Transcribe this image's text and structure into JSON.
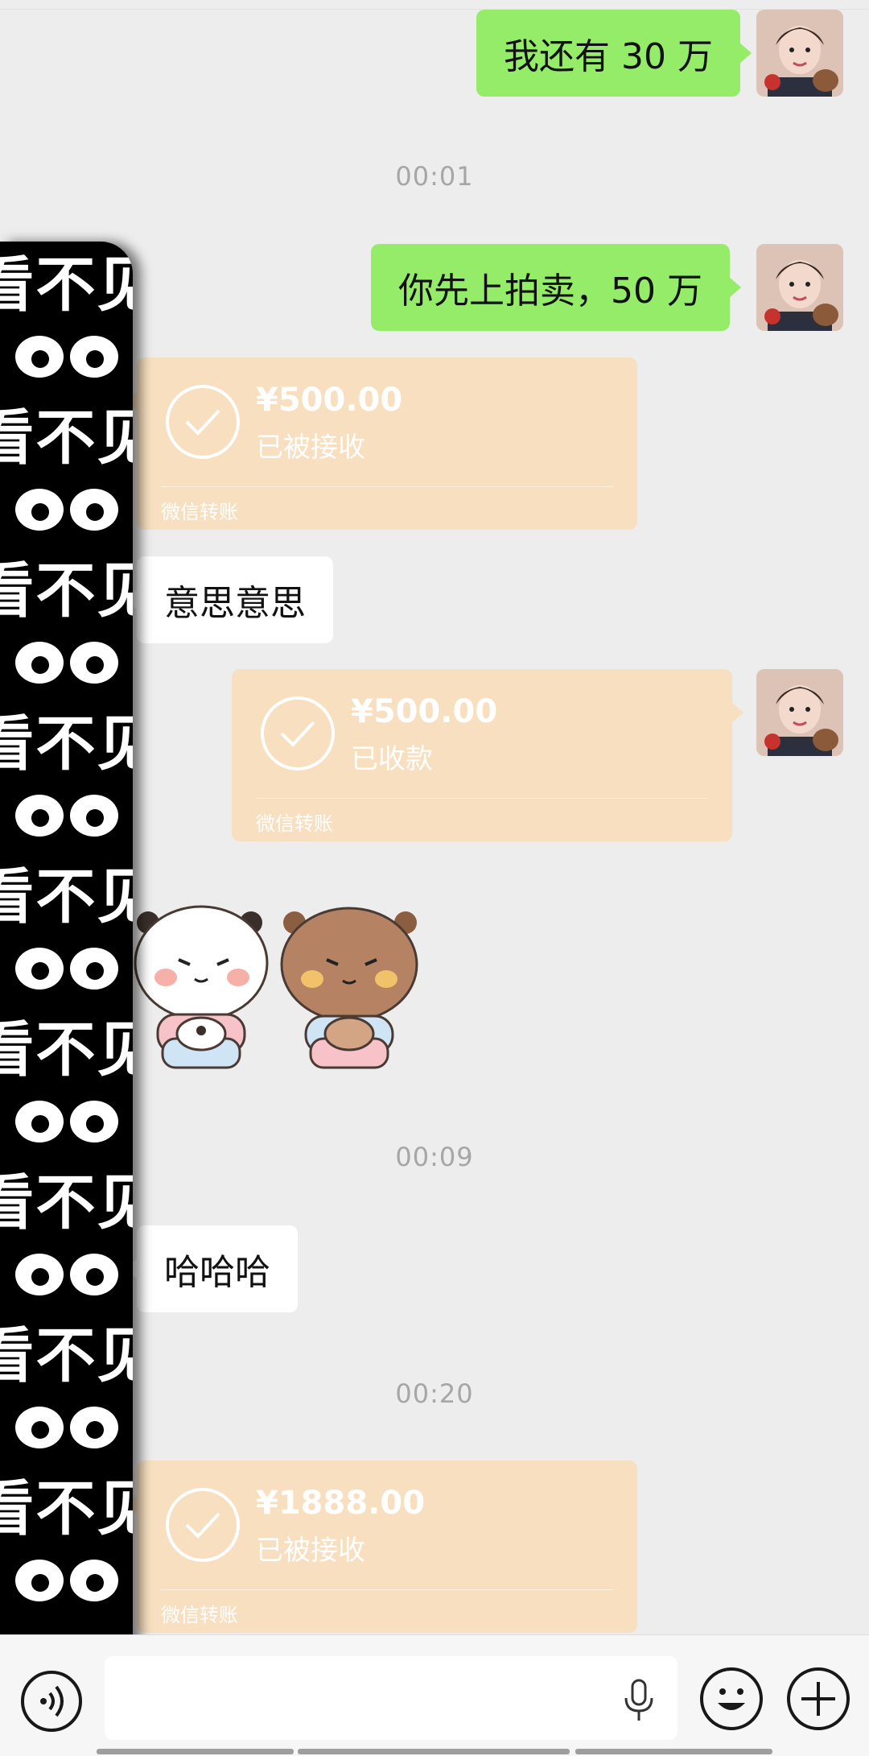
{
  "messages": [
    {
      "type": "text",
      "direction": "out",
      "text": "我还有 30 万"
    },
    {
      "type": "time",
      "text": "00:01"
    },
    {
      "type": "text",
      "direction": "out",
      "text": "你先上拍卖，50 万"
    },
    {
      "type": "transfer",
      "direction": "in",
      "amount": "¥500.00",
      "status": "已被接收",
      "label": "微信转账"
    },
    {
      "type": "text",
      "direction": "in",
      "text": "意思意思"
    },
    {
      "type": "transfer",
      "direction": "out",
      "amount": "¥500.00",
      "status": "已收款",
      "label": "微信转账"
    },
    {
      "type": "sticker",
      "icon": "panda-and-bear-sticker"
    },
    {
      "type": "time",
      "text": "00:09"
    },
    {
      "type": "text",
      "direction": "in",
      "text": "哈哈哈"
    },
    {
      "type": "time",
      "text": "00:20"
    },
    {
      "type": "transfer",
      "direction": "in",
      "amount": "¥1888.00",
      "status": "已被接收",
      "label": "微信转账"
    }
  ],
  "redaction": {
    "text": "看不见",
    "icon": "eyes-pattern"
  },
  "input_bar": {
    "voice_icon": "voice-icon",
    "mic_icon": "microphone-icon",
    "emoji_icon": "emoji-icon",
    "plus_icon": "plus-icon"
  },
  "colors": {
    "background": "#ededed",
    "outgoing_bubble": "#95ec69",
    "incoming_bubble": "#ffffff",
    "transfer_card": "#f7dfc0"
  }
}
